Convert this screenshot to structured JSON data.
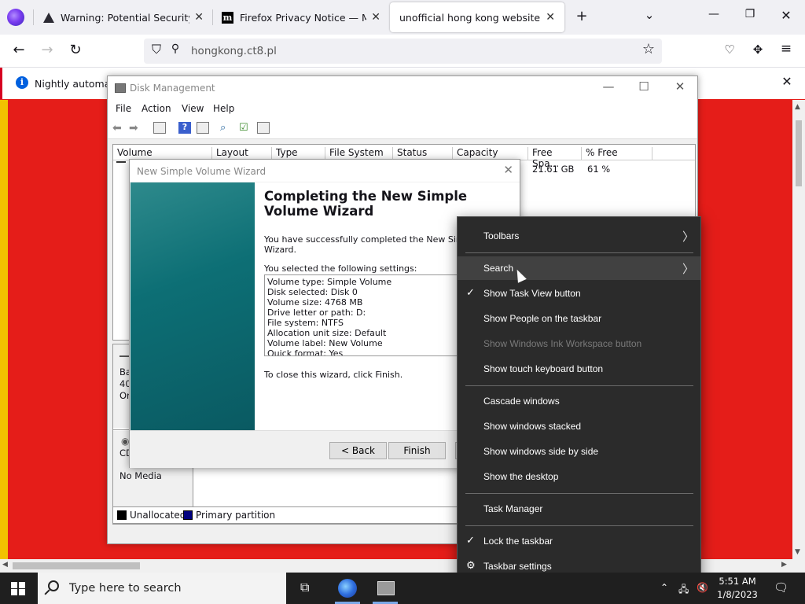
{
  "browser": {
    "tabs": [
      {
        "title": "Warning: Potential Security Risk",
        "icon": "warning-icon"
      },
      {
        "title": "Firefox Privacy Notice — Mozilla",
        "icon": "mozilla-icon"
      },
      {
        "title": "unofficial hong kong website",
        "icon": ""
      }
    ],
    "url": "hongkong.ct8.pl",
    "notification": "Nightly automation"
  },
  "disk_mgmt": {
    "title": "Disk Management",
    "menu": [
      "File",
      "Action",
      "View",
      "Help"
    ],
    "columns": [
      "Volume",
      "Layout",
      "Type",
      "File System",
      "Status",
      "Capacity",
      "Free Spa...",
      "% Free"
    ],
    "row": {
      "free_space": "21.61 GB",
      "pct_free": "61 %"
    },
    "disk_labels": [
      "Bas",
      "40.",
      "On",
      "CD",
      "No Media"
    ],
    "legend": [
      {
        "label": "Unallocated",
        "color": "#000000"
      },
      {
        "label": "Primary partition",
        "color": "#00007f"
      }
    ]
  },
  "wizard": {
    "title": "New Simple Volume Wizard",
    "heading": "Completing the New Simple Volume Wizard",
    "intro_line1": "You have successfully completed the New Simple V",
    "intro_line2": "Wizard.",
    "selected_label": "You selected the following settings:",
    "settings": [
      "Volume type: Simple Volume",
      "Disk selected: Disk 0",
      "Volume size: 4768 MB",
      "Drive letter or path: D:",
      "File system: NTFS",
      "Allocation unit size: Default",
      "Volume label: New Volume",
      "Quick format: Yes"
    ],
    "close_text": "To close this wizard, click Finish.",
    "back": "< Back",
    "finish": "Finish"
  },
  "context_menu": {
    "items": [
      {
        "label": "Toolbars",
        "submenu": true
      },
      {
        "label": "Search",
        "submenu": true,
        "highlighted": true
      },
      {
        "label": "Show Task View button",
        "checked": true
      },
      {
        "label": "Show People on the taskbar"
      },
      {
        "label": "Show Windows Ink Workspace button",
        "disabled": true
      },
      {
        "label": "Show touch keyboard button"
      },
      {
        "label": "Cascade windows"
      },
      {
        "label": "Show windows stacked"
      },
      {
        "label": "Show windows side by side"
      },
      {
        "label": "Show the desktop"
      },
      {
        "label": "Task Manager"
      },
      {
        "label": "Lock the taskbar",
        "checked": true
      },
      {
        "label": "Taskbar settings",
        "icon": "gear-icon"
      }
    ]
  },
  "taskbar": {
    "search_placeholder": "Type here to search",
    "time": "5:51 AM",
    "date": "1/8/2023"
  }
}
